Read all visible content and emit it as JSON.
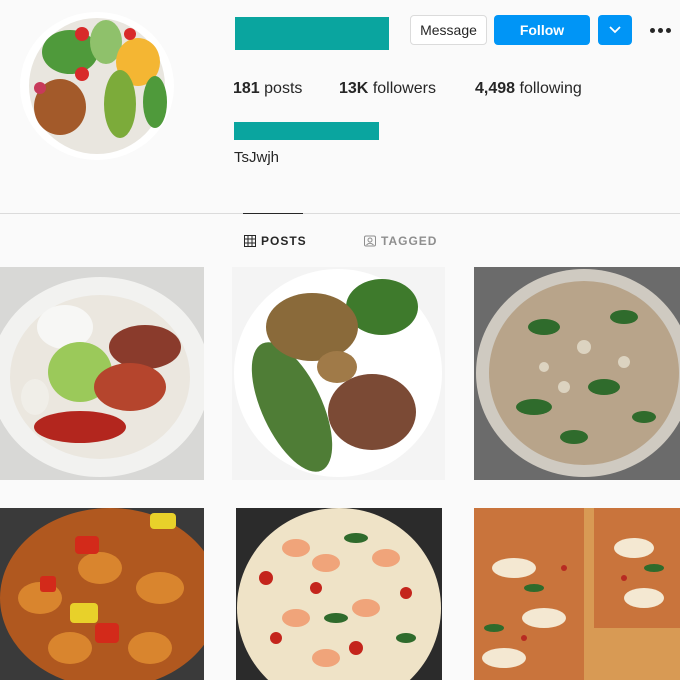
{
  "profile": {
    "display_name": "TsJwjh",
    "avatar_desc": "food-bowl-photo"
  },
  "actions": {
    "message_label": "Message",
    "follow_label": "Follow"
  },
  "stats": {
    "posts_count": "181",
    "posts_label": "posts",
    "followers_count": "13K",
    "followers_label": "followers",
    "following_count": "4,498",
    "following_label": "following"
  },
  "tabs": [
    {
      "label": "POSTS",
      "icon": "grid-icon",
      "active": true
    },
    {
      "label": "TAGGED",
      "icon": "tagged-icon",
      "active": false
    }
  ],
  "colors": {
    "accent": "#0095f6",
    "redaction": "#0aa59f",
    "text": "#262626",
    "muted": "#8e8e8e"
  }
}
